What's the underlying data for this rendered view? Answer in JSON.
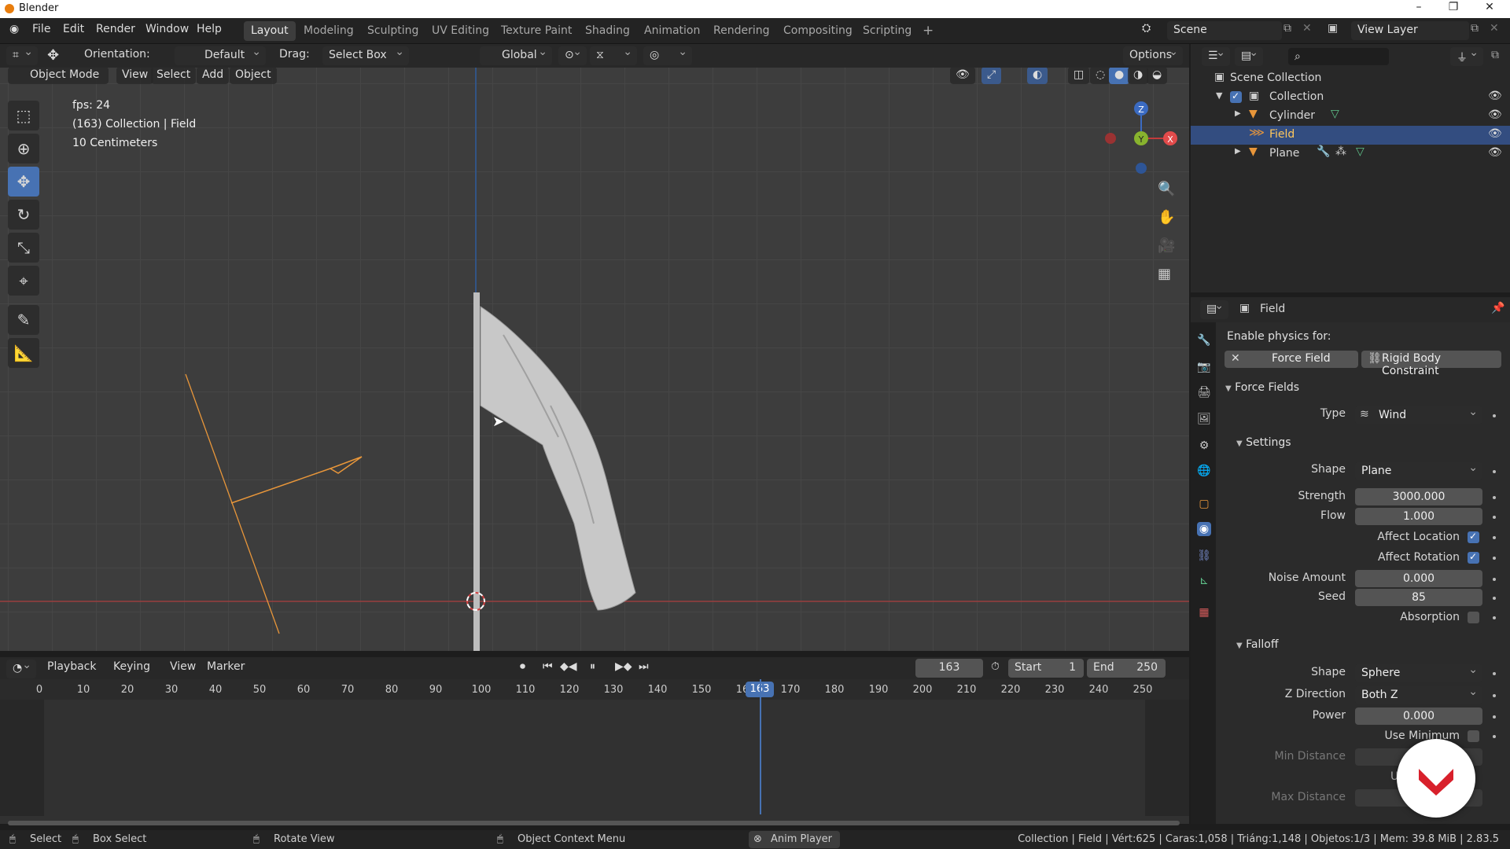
{
  "window": {
    "title": "Blender"
  },
  "menu": [
    "File",
    "Edit",
    "Render",
    "Window",
    "Help"
  ],
  "workspaces": [
    "Layout",
    "Modeling",
    "Sculpting",
    "UV Editing",
    "Texture Paint",
    "Shading",
    "Animation",
    "Rendering",
    "Compositing",
    "Scripting"
  ],
  "active_workspace": "Layout",
  "scene": {
    "name": "Scene",
    "view_layer": "View Layer"
  },
  "toolbar": {
    "orientation_label": "Orientation:",
    "orientation_value": "Default",
    "drag_label": "Drag:",
    "drag_value": "Select Box",
    "transform_orientation": "Global",
    "options": "Options"
  },
  "viewport_menu": {
    "mode": "Object Mode",
    "items": [
      "View",
      "Select",
      "Add",
      "Object"
    ]
  },
  "viewport_info": {
    "fps": "fps: 24",
    "context": "(163) Collection | Field",
    "scale": "10 Centimeters"
  },
  "gizmo": {
    "z": "Z",
    "y": "Y",
    "x": "X"
  },
  "outliner": {
    "root": "Scene Collection",
    "items": [
      {
        "name": "Collection"
      },
      {
        "name": "Cylinder"
      },
      {
        "name": "Field"
      },
      {
        "name": "Plane"
      }
    ]
  },
  "properties": {
    "object": "Field",
    "enable_physics": "Enable physics for:",
    "force_field_btn": "Force Field",
    "rigid_body_btn": "Rigid Body Constraint",
    "section_force_fields": "Force Fields",
    "type_label": "Type",
    "type_value": "Wind",
    "section_settings": "Settings",
    "shape_label": "Shape",
    "shape_value": "Plane",
    "strength_label": "Strength",
    "strength_value": "3000.000",
    "flow_label": "Flow",
    "flow_value": "1.000",
    "affect_location": "Affect Location",
    "affect_rotation": "Affect Rotation",
    "noise_label": "Noise Amount",
    "noise_value": "0.000",
    "seed_label": "Seed",
    "seed_value": "85",
    "absorption": "Absorption",
    "section_falloff": "Falloff",
    "falloff_shape_label": "Shape",
    "falloff_shape_value": "Sphere",
    "zdir_label": "Z Direction",
    "zdir_value": "Both Z",
    "power_label": "Power",
    "power_value": "0.000",
    "use_minimum": "Use Minimum",
    "min_distance": "Min Distance",
    "max_distance": "Max Distance",
    "partial_u": "U"
  },
  "timeline": {
    "menu": [
      "Playback",
      "Keying",
      "View",
      "Marker"
    ],
    "current_frame": "163",
    "start_label": "Start",
    "start_value": "1",
    "end_label": "End",
    "end_value": "250",
    "ticks": [
      "0",
      "10",
      "20",
      "30",
      "40",
      "50",
      "60",
      "70",
      "80",
      "90",
      "100",
      "110",
      "120",
      "130",
      "140",
      "150",
      "16",
      "170",
      "180",
      "190",
      "200",
      "210",
      "220",
      "230",
      "240",
      "250"
    ]
  },
  "status": {
    "select": "Select",
    "box_select": "Box Select",
    "rotate_view": "Rotate View",
    "context_menu": "Object Context Menu",
    "anim_player": "Anim Player",
    "stats": "Collection | Field | Vért:625 | Caras:1,058 | Triáng:1,148 | Objetos:1/3 | Mem: 39.8 MiB | 2.83.5"
  }
}
